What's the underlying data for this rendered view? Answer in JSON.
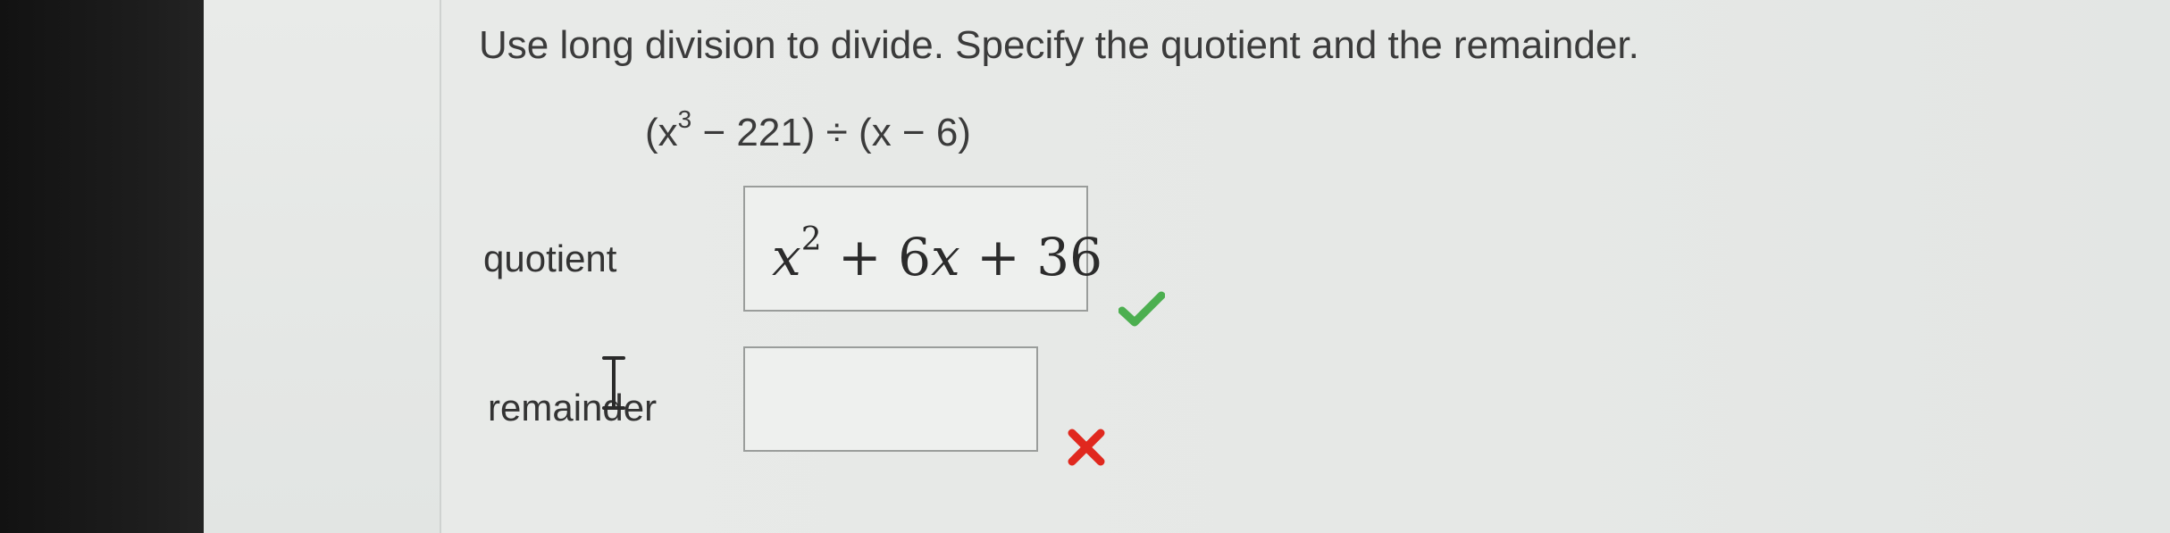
{
  "question": {
    "instruction": "Use long division to divide. Specify the quotient and the remainder.",
    "expression": {
      "open": "(x",
      "exponent": "3",
      "rest": " − 221) ÷ (x − 6)"
    }
  },
  "quotient": {
    "label": "quotient",
    "answer": {
      "var": "x",
      "exponent": "2",
      "rest": " + 6",
      "var2": "x",
      "rest2": " + 36"
    },
    "status": "correct",
    "status_icon": "checkmark-icon",
    "status_color": "#4caf50"
  },
  "remainder": {
    "label": "remainder",
    "value": "",
    "status": "incorrect",
    "status_icon": "x-mark-icon",
    "status_color": "#e0281e"
  },
  "cursor": {
    "icon": "text-cursor-icon"
  }
}
